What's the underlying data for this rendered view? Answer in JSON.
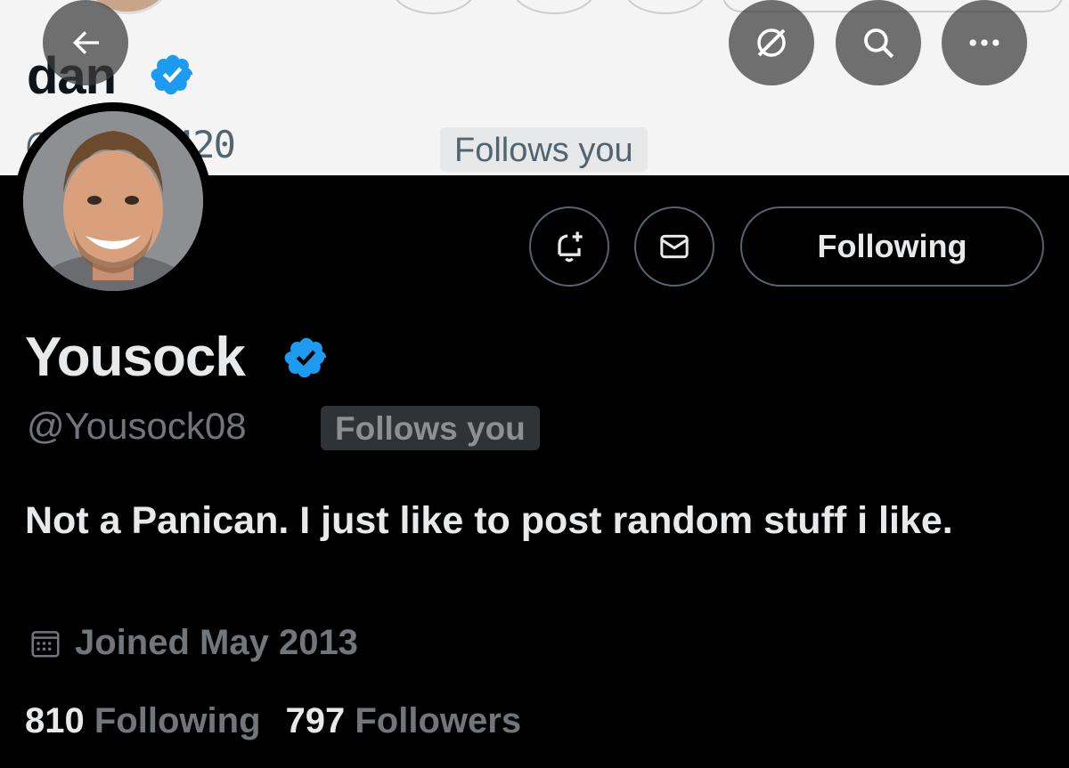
{
  "header": {
    "name": "dan",
    "handle_partial": "@676935420",
    "follows_badge": "Follows you"
  },
  "profile": {
    "name": "Yousock",
    "handle": "@Yousock08",
    "follows_badge": "Follows you",
    "bio": "Not a Panican. I just like to post random stuff i like.",
    "joined": "Joined May 2013",
    "following_count": "810",
    "following_label": "Following",
    "followers_count": "797",
    "followers_label": "Followers"
  },
  "actions": {
    "following_button": "Following"
  },
  "colors": {
    "verified": "#1d9bf0",
    "background": "#000000",
    "text_primary": "#e7e9ea",
    "text_secondary": "#71767b"
  },
  "icons": [
    "back-arrow-icon",
    "grok-icon",
    "search-icon",
    "more-icon",
    "notification-bell-plus-icon",
    "message-icon",
    "verified-icon",
    "calendar-icon"
  ]
}
